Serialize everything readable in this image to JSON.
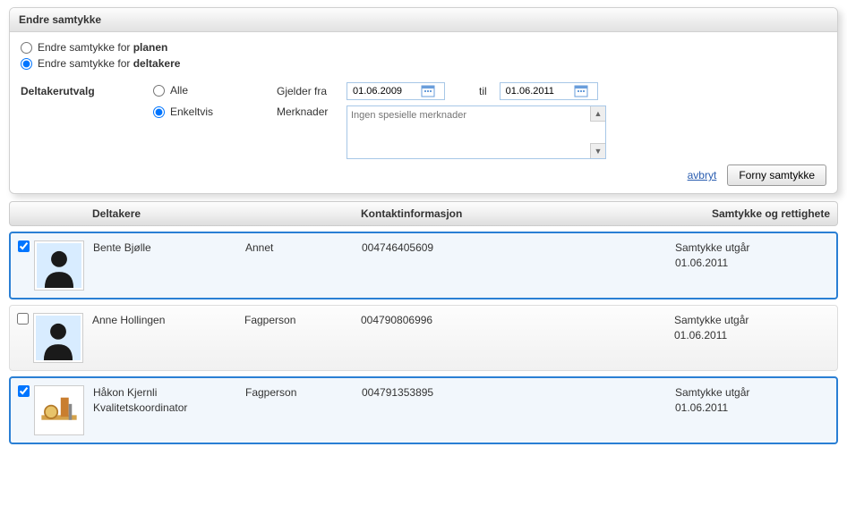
{
  "panel": {
    "title": "Endre samtykke",
    "opt_plan_prefix": "Endre samtykke for ",
    "opt_plan_bold": "planen",
    "opt_participants_prefix": "Endre samtykke for ",
    "opt_participants_bold": "deltakere"
  },
  "selection": {
    "label": "Deltakerutvalg",
    "opt_all": "Alle",
    "opt_individual": "Enkeltvis"
  },
  "fields": {
    "from_label": "Gjelder fra",
    "from_value": "01.06.2009",
    "to_label": "til",
    "to_value": "01.06.2011",
    "notes_label": "Merknader",
    "notes_placeholder": "Ingen spesielle merknader"
  },
  "actions": {
    "cancel": "avbryt",
    "renew": "Forny samtykke"
  },
  "grid": {
    "header": {
      "participants": "Deltakere",
      "contact": "Kontaktinformasjon",
      "consent": "Samtykke og rettighete"
    },
    "rows": [
      {
        "checked": true,
        "name": "Bente Bjølle",
        "subtitle": "",
        "role": "Annet",
        "contact": "004746405609",
        "consent_line1": "Samtykke utgår",
        "consent_line2": "01.06.2011",
        "avatar": "silhouette"
      },
      {
        "checked": false,
        "name": "Anne Hollingen",
        "subtitle": "",
        "role": "Fagperson",
        "contact": "004790806996",
        "consent_line1": "Samtykke utgår",
        "consent_line2": "01.06.2011",
        "avatar": "silhouette"
      },
      {
        "checked": true,
        "name": "Håkon Kjernli",
        "subtitle": "Kvalitetskoordinator",
        "role": "Fagperson",
        "contact": "004791353895",
        "consent_line1": "Samtykke utgår",
        "consent_line2": "01.06.2011",
        "avatar": "tools"
      }
    ]
  }
}
